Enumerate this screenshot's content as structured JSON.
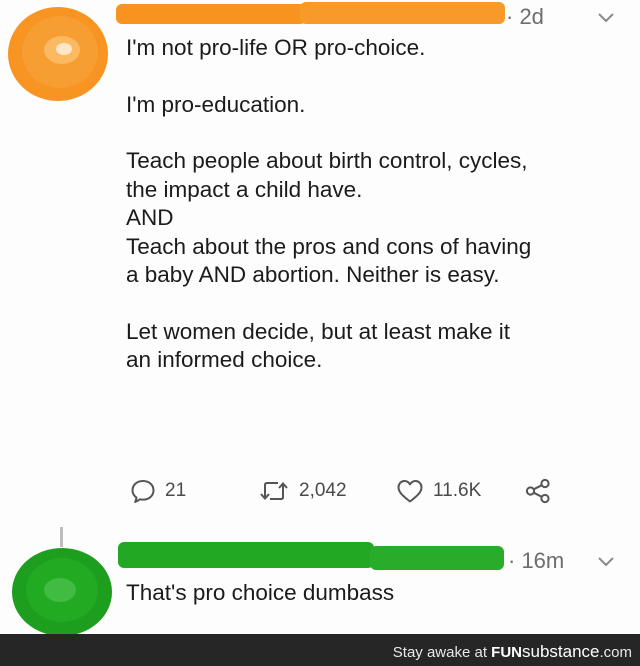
{
  "post": {
    "timestamp": "· 2d",
    "paragraphs": [
      "I'm not pro-life OR pro-choice.",
      "I'm pro-education.",
      "Teach people about birth control, cycles,\nthe impact a child have.\nAND\nTeach about the pros and cons of having\na baby AND abortion. Neither is easy.",
      "Let women decide, but at least make it\nan informed choice."
    ],
    "actions": {
      "replies": "21",
      "retweets": "2,042",
      "likes": "11.6K"
    },
    "icons": {
      "reply": "comment-icon",
      "retweet": "retweet-icon",
      "like": "heart-icon",
      "share": "share-icon",
      "menu": "chevron-down-icon"
    },
    "avatar_color": "#F7931E",
    "redaction_color": "#F7931E"
  },
  "reply": {
    "timestamp": "· 16m",
    "text": "That's pro choice dumbass",
    "avatar_color": "#1FA51F",
    "redaction_color": "#22A822"
  },
  "watermark": {
    "prefix": "Stay awake at ",
    "brand_bold": "FUN",
    "brand_rest": "substance",
    "suffix": ".com"
  }
}
